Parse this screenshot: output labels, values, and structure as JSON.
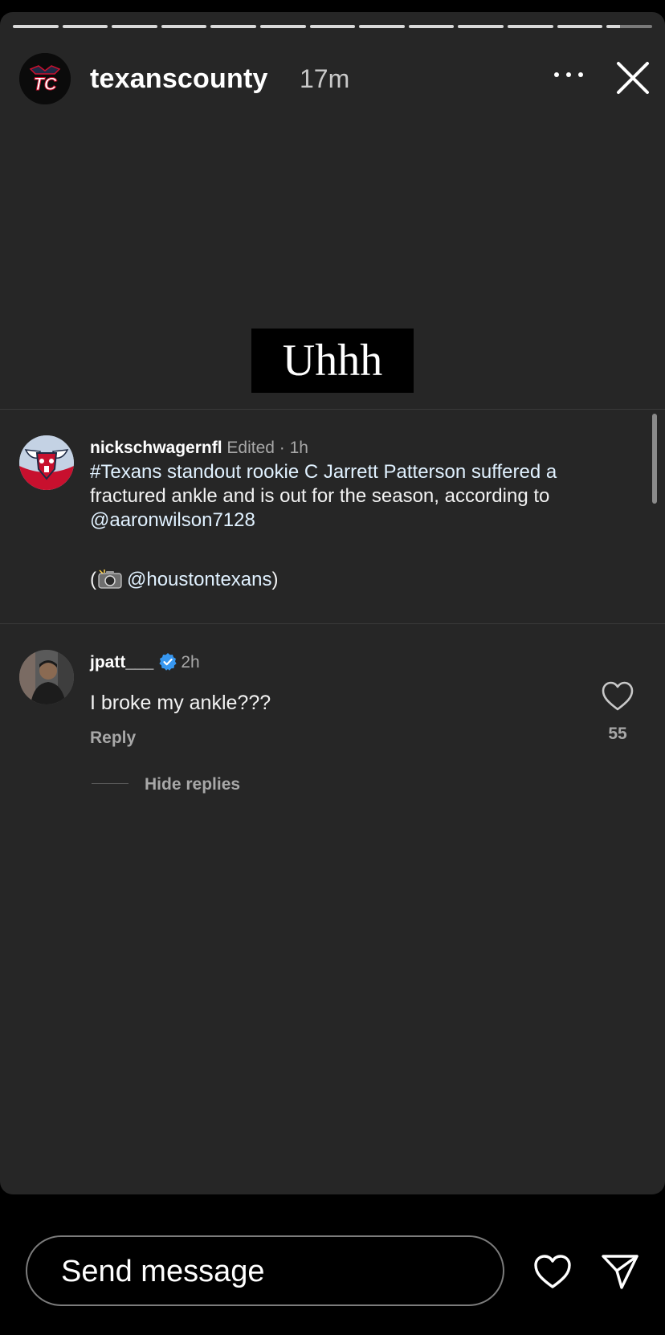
{
  "story": {
    "progress_segments": 13,
    "current_segment_fill": 0.3,
    "account": {
      "username": "texanscounty",
      "time": "17m",
      "avatar_text": "TC"
    },
    "sticker_text": "Uhhh"
  },
  "post": {
    "username": "nickschwagernfl",
    "meta": "Edited · 1h",
    "lines": [
      "#Texans standout rookie C Jarrett Patterson suffered a",
      "fractured ankle and is out for the season, according to",
      "@aaronwilson7128"
    ],
    "credit_open": "(",
    "credit_mention": "@houstontexans",
    "credit_close": ")"
  },
  "comment": {
    "username": "jpatt___",
    "time": "2h",
    "text": "I broke my ankle???",
    "reply_label": "Reply",
    "like_count": "55",
    "hide_replies_label": "Hide replies"
  },
  "composer": {
    "placeholder": "Send message"
  },
  "colors": {
    "background": "#000000",
    "card": "#262626",
    "muted_text": "#a8a8a8",
    "verified_blue": "#3797f0"
  }
}
